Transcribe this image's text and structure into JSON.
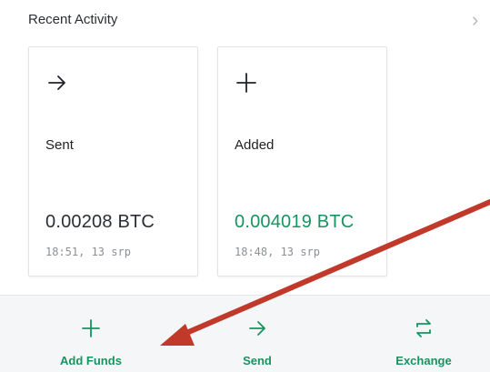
{
  "header": {
    "title": "Recent Activity",
    "chevron": "›"
  },
  "cards": [
    {
      "type": "Sent",
      "icon": "arrow-right-icon",
      "amount": "0.00208 BTC",
      "time": "18:51, 13 srp"
    },
    {
      "type": "Added",
      "icon": "plus-icon",
      "amount": "0.004019 BTC",
      "time": "18:48, 13 srp"
    }
  ],
  "actions": [
    {
      "label": "Add Funds",
      "icon": "plus-icon"
    },
    {
      "label": "Send",
      "icon": "arrow-right-icon"
    },
    {
      "label": "Exchange",
      "icon": "swap-icon"
    }
  ],
  "colors": {
    "accent": "#17945f",
    "annotation_arrow": "#c0392b",
    "bar_bg": "#f4f6f8"
  }
}
